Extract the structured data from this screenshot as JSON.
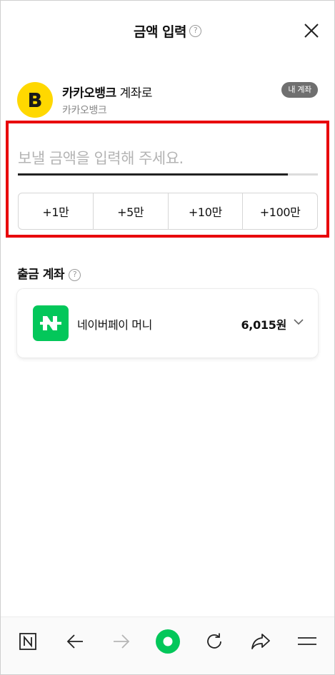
{
  "header": {
    "title": "금액 입력",
    "help_icon_glyph": "?",
    "close_icon": "close-icon"
  },
  "recipient": {
    "bank_initial": "B",
    "bank_name": "카카오뱅크",
    "suffix": " 계좌로",
    "sub_label": "카카오뱅크",
    "badge": "내 계좌",
    "logo_color": "#FFD800"
  },
  "amount": {
    "placeholder": "보낼 금액을 입력해 주세요.",
    "track_fill_fraction": 0.9,
    "quick_buttons": [
      "+1만",
      "+5만",
      "+10만",
      "+100만"
    ]
  },
  "source": {
    "label": "출금 계좌",
    "help_icon_glyph": "?",
    "account_name": "네이버페이 머니",
    "balance": "6,015원",
    "brand_color": "#03C75A"
  },
  "bottom_nav": {
    "items": [
      "naver-home-icon",
      "back-arrow-icon",
      "forward-arrow-icon",
      "green-dot-icon",
      "refresh-icon",
      "share-icon",
      "menu-icon"
    ],
    "accent": "#03C75A"
  },
  "colors": {
    "highlight_border": "#E8000B",
    "placeholder": "#B4B4B4",
    "badge_bg": "#6F6F6F"
  }
}
